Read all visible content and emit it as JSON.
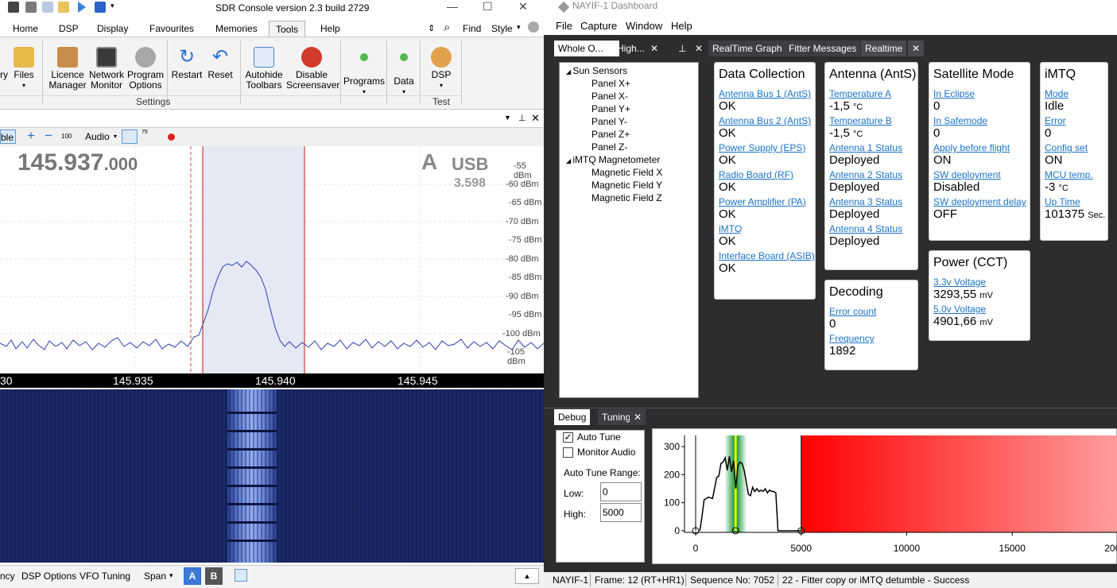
{
  "sdr": {
    "title": "SDR Console version 2.3 build 2729",
    "menu": [
      "Home",
      "DSP",
      "Display",
      "Favourites",
      "Memories",
      "Tools",
      "Help"
    ],
    "active_menu": "Tools",
    "find": "Find",
    "style": "Style",
    "ribbon": {
      "items": [
        {
          "label": "ry"
        },
        {
          "label": "Files"
        },
        {
          "label": "Licence\nManager"
        },
        {
          "label": "Network\nMonitor"
        },
        {
          "label": "Program\nOptions"
        },
        {
          "label": "Restart"
        },
        {
          "label": "Reset"
        },
        {
          "label": "Autohide\nToolbars"
        },
        {
          "label": "Disable\nScreensaver"
        },
        {
          "label": "Programs"
        },
        {
          "label": "Data"
        },
        {
          "label": "DSP"
        }
      ],
      "group_settings": "Settings",
      "group_test": "Test"
    },
    "toolbar": {
      "left_label": "ble",
      "zoom": "100",
      "audio": "Audio",
      "mini": "75"
    },
    "frequency": {
      "main": "145.937",
      "fine": ".000",
      "vfo": "A",
      "mode": "USB",
      "sub": "3.598"
    },
    "dbm_ticks": [
      "-55 dBm",
      "-60 dBm",
      "-65 dBm",
      "-70 dBm",
      "-75 dBm",
      "-80 dBm",
      "-85 dBm",
      "-90 dBm",
      "-95 dBm",
      "-100 dBm",
      "-105 dBm"
    ],
    "freq_ticks": [
      "30",
      "145.935",
      "145.940",
      "145.945"
    ],
    "bottom": [
      "ncy",
      "DSP Options",
      "VFO Tuning",
      "Span"
    ],
    "vfo_buttons": [
      "A",
      "B"
    ]
  },
  "nayif": {
    "title": "NAYIF-1 Dashboard",
    "menu": [
      "File",
      "Capture",
      "Window",
      "Help"
    ],
    "left_tabs": [
      "Whole O...",
      "High..."
    ],
    "main_tabs": [
      "RealTime Graph",
      "Fitter Messages",
      "Realtime"
    ],
    "tree": [
      {
        "label": "Sun Sensors",
        "level": 0
      },
      {
        "label": "Panel X+",
        "level": 1
      },
      {
        "label": "Panel X-",
        "level": 1
      },
      {
        "label": "Panel Y+",
        "level": 1
      },
      {
        "label": "Panel Y-",
        "level": 1
      },
      {
        "label": "Panel Z+",
        "level": 1
      },
      {
        "label": "Panel Z-",
        "level": 1
      },
      {
        "label": "iMTQ Magnetometer",
        "level": 0
      },
      {
        "label": "Magnetic Field X",
        "level": 1
      },
      {
        "label": "Magnetic Field Y",
        "level": 1
      },
      {
        "label": "Magnetic Field Z",
        "level": 1
      }
    ],
    "cards": {
      "data_collection": {
        "title": "Data Collection",
        "items": [
          {
            "label": "Antenna Bus 1 (AntS)",
            "value": "OK"
          },
          {
            "label": "Antenna Bus 2 (AntS)",
            "value": "OK"
          },
          {
            "label": "Power Supply (EPS)",
            "value": "OK"
          },
          {
            "label": "Radio Board (RF)",
            "value": "OK"
          },
          {
            "label": "Power Amplifier (PA)",
            "value": "OK"
          },
          {
            "label": "iMTQ",
            "value": "OK"
          },
          {
            "label": "Interface Board (ASIB)",
            "value": "OK"
          }
        ]
      },
      "antenna": {
        "title": "Antenna (AntS)",
        "items": [
          {
            "label": "Temperature A",
            "value": "-1,5",
            "unit": "°C"
          },
          {
            "label": "Temperature B",
            "value": "-1,5",
            "unit": "°C"
          },
          {
            "label": "Antenna 1 Status",
            "value": "Deployed"
          },
          {
            "label": "Antenna 2 Status",
            "value": "Deployed"
          },
          {
            "label": "Antenna 3 Status",
            "value": "Deployed"
          },
          {
            "label": "Antenna 4 Status",
            "value": "Deployed"
          }
        ]
      },
      "decoding": {
        "title": "Decoding",
        "items": [
          {
            "label": "Error count",
            "value": "0"
          },
          {
            "label": "Frequency",
            "value": "1892"
          }
        ]
      },
      "satellite_mode": {
        "title": "Satellite Mode",
        "items": [
          {
            "label": "In Eclipse",
            "value": "0"
          },
          {
            "label": "In Safemode",
            "value": "0"
          },
          {
            "label": "Apply before flight",
            "value": "ON"
          },
          {
            "label": "SW deployment",
            "value": "Disabled"
          },
          {
            "label": "SW deployment delay",
            "value": "OFF"
          }
        ]
      },
      "power": {
        "title": "Power (CCT)",
        "items": [
          {
            "label": "3.3v Voltage",
            "value": "3293,55",
            "unit": "mV"
          },
          {
            "label": "5.0v Voltage",
            "value": "4901,66",
            "unit": "mV"
          }
        ]
      },
      "imtq": {
        "title": "iMTQ",
        "items": [
          {
            "label": "Mode",
            "value": "Idle"
          },
          {
            "label": "Error",
            "value": "0"
          },
          {
            "label": "Config set",
            "value": "ON"
          },
          {
            "label": "MCU temp.",
            "value": "-3",
            "unit": "°C"
          },
          {
            "label": "Up Time",
            "value": "101375",
            "unit": "Sec."
          }
        ]
      }
    },
    "bottom_tabs": [
      "Debug",
      "Tuning"
    ],
    "tuning": {
      "auto_tune": "Auto Tune",
      "auto_tune_checked": true,
      "monitor_audio": "Monitor Audio",
      "monitor_checked": false,
      "range_label": "Auto Tune Range:",
      "low_label": "Low:",
      "low_value": "0",
      "high_label": "High:",
      "high_value": "5000"
    },
    "status": {
      "name": "NAYIF-1",
      "frame": "Frame: 12 (RT+HR1)",
      "sequence": "Sequence No: 7052",
      "message": "22 - Fitter copy or iMTQ detumble - Success"
    }
  },
  "chart_data": {
    "type": "line",
    "x_ticks": [
      "0",
      "5000",
      "10000",
      "15000",
      "20000"
    ],
    "y_ticks": [
      "300",
      "200",
      "100",
      "0"
    ],
    "xlim": [
      0,
      20000
    ],
    "ylim": [
      0,
      300
    ],
    "selected_range": [
      0,
      5000
    ],
    "marker_x": 1892,
    "series": [
      {
        "x": [
          200,
          300,
          400,
          600,
          800,
          1000,
          1100,
          1200,
          1300,
          1400,
          1500,
          1600,
          1700,
          1800,
          1900,
          2000,
          2100,
          2200,
          2300,
          2500,
          2600,
          2700,
          2800,
          2900,
          3000,
          3100,
          3200,
          3300,
          3400,
          3500,
          3600,
          3700,
          3800,
          3900,
          4000,
          5000
        ],
        "values": [
          0,
          50,
          110,
          120,
          115,
          190,
          195,
          240,
          245,
          260,
          215,
          265,
          210,
          250,
          150,
          230,
          245,
          240,
          215,
          130,
          125,
          155,
          140,
          150,
          140,
          145,
          140,
          150,
          135,
          145,
          140,
          140,
          135,
          0,
          0,
          0
        ]
      }
    ]
  }
}
